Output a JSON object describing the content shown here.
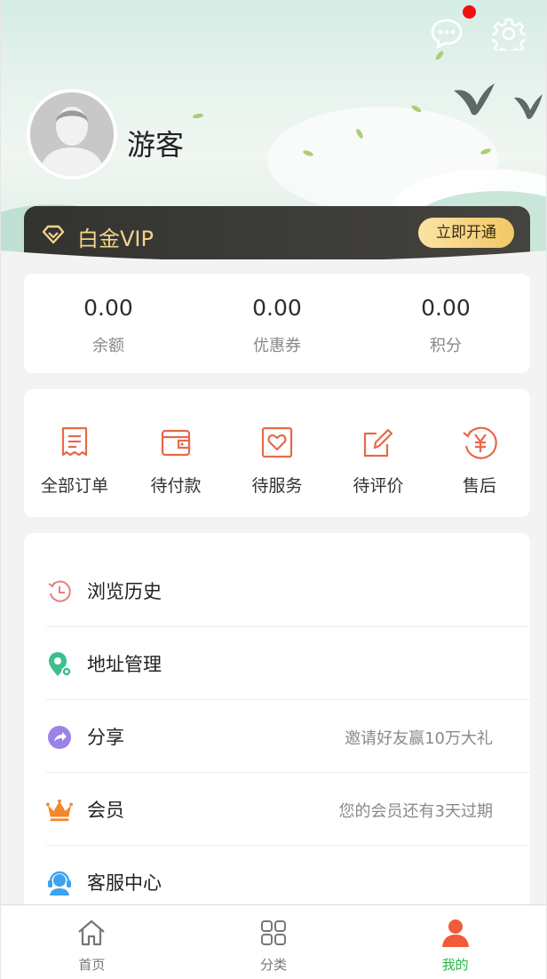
{
  "header": {
    "username": "游客"
  },
  "vip": {
    "label": "白金VIP",
    "button": "立即开通"
  },
  "stats": [
    {
      "value": "0.00",
      "label": "余额"
    },
    {
      "value": "0.00",
      "label": "优惠券"
    },
    {
      "value": "0.00",
      "label": "积分"
    }
  ],
  "orders": [
    {
      "label": "全部订单",
      "icon": "order-list-icon"
    },
    {
      "label": "待付款",
      "icon": "wallet-icon"
    },
    {
      "label": "待服务",
      "icon": "heart-box-icon"
    },
    {
      "label": "待评价",
      "icon": "edit-icon"
    },
    {
      "label": "售后",
      "icon": "refund-yen-icon"
    }
  ],
  "menu": [
    {
      "label": "浏览历史",
      "hint": "",
      "icon": "history-icon"
    },
    {
      "label": "地址管理",
      "hint": "",
      "icon": "location-icon"
    },
    {
      "label": "分享",
      "hint": "邀请好友赢10万大礼",
      "icon": "share-icon"
    },
    {
      "label": "会员",
      "hint": "您的会员还有3天过期",
      "icon": "crown-icon"
    },
    {
      "label": "客服中心",
      "hint": "",
      "icon": "customer-service-icon"
    }
  ],
  "tabs": [
    {
      "label": "首页",
      "icon": "home-icon"
    },
    {
      "label": "分类",
      "icon": "category-icon"
    },
    {
      "label": "我的",
      "icon": "user-icon"
    }
  ],
  "colors": {
    "accent": "#e8684a",
    "tab_active": "#28b84a",
    "vip_gold": "#f3d38a"
  }
}
